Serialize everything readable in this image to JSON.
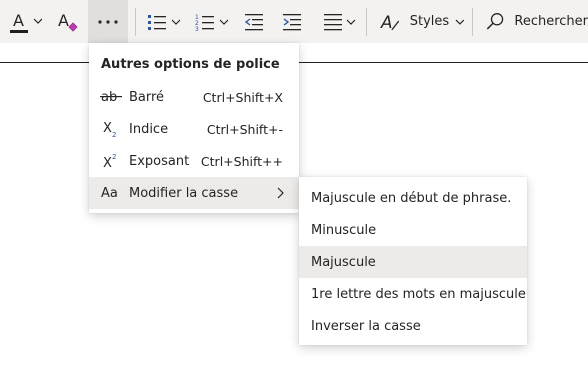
{
  "toolbar": {
    "font_color_icon": "font-color-icon",
    "clear_formatting_icon": "clear-formatting-icon",
    "more_icon": "more-options-icon",
    "bullets_icon": "bullets-icon",
    "numbering_icon": "numbering-icon",
    "decrease_indent_icon": "decrease-indent-icon",
    "increase_indent_icon": "increase-indent-icon",
    "align_icon": "align-icon",
    "styles_icon": "styles-icon",
    "styles_label": "Styles",
    "search_icon": "search-icon",
    "search_label": "Rechercher"
  },
  "font_menu": {
    "heading": "Autres options de police",
    "items": [
      {
        "icon_text": "ab",
        "label": "Barré",
        "shortcut": "Ctrl+Shift+X"
      },
      {
        "icon_text": "X",
        "icon_sub": "2",
        "label": "Indice",
        "shortcut": "Ctrl+Shift+-"
      },
      {
        "icon_text": "X",
        "icon_sup": "2",
        "label": "Exposant",
        "shortcut": "Ctrl+Shift++"
      },
      {
        "icon_text": "Aa",
        "label": "Modifier la casse",
        "shortcut": ""
      }
    ]
  },
  "case_submenu": {
    "items": [
      "Majuscule en début de phrase.",
      "Minuscule",
      "Majuscule",
      "1re lettre des mots en majuscule",
      "Inverser la casse"
    ],
    "highlighted": "Majuscule"
  },
  "colors": {
    "ribbon_bg": "#f3f2f1",
    "highlight": "#edebe9",
    "text": "#252423",
    "icon_blue": "#2b5797"
  }
}
